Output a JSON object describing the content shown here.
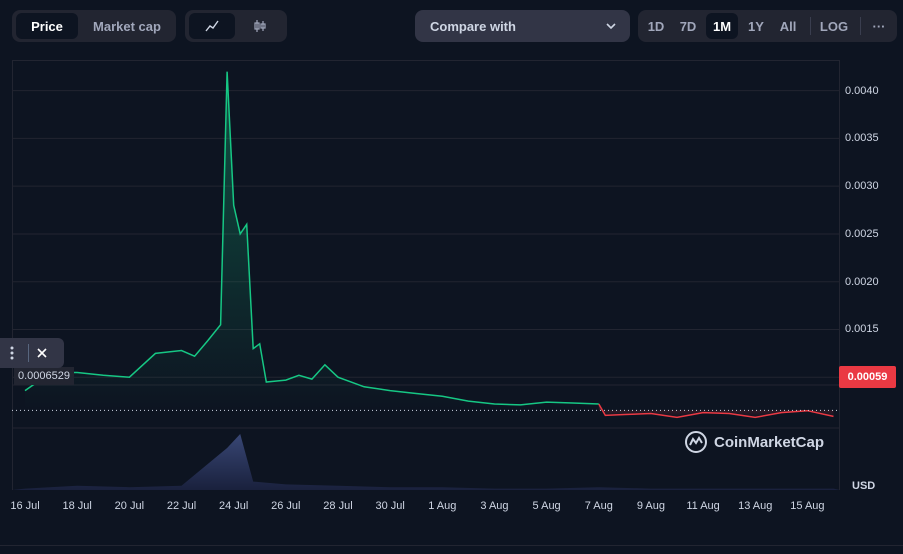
{
  "toolbar": {
    "data_tabs": [
      {
        "label": "Price",
        "active": true
      },
      {
        "label": "Market cap",
        "active": false
      }
    ],
    "chart_types": [
      {
        "icon": "line-chart-icon",
        "active": true
      },
      {
        "icon": "candlestick-icon",
        "active": false
      }
    ],
    "compare_label": "Compare with",
    "ranges": [
      {
        "label": "1D",
        "active": false
      },
      {
        "label": "7D",
        "active": false
      },
      {
        "label": "1M",
        "active": true
      },
      {
        "label": "1Y",
        "active": false
      },
      {
        "label": "All",
        "active": false
      }
    ],
    "log_label": "LOG",
    "more_label": "···"
  },
  "colors": {
    "up": "#16c784",
    "down": "#ea3943",
    "background": "#0d1421",
    "grid": "#222531"
  },
  "current_price_label": "0.00059",
  "hover_price_label": "0.0006529",
  "currency_label": "USD",
  "brand": "CoinMarketCap",
  "chart_data": {
    "type": "line",
    "title": "",
    "xlabel": "",
    "ylabel": "",
    "currency": "USD",
    "ylim": [
      0.0005,
      0.0043
    ],
    "y_ticks": [
      {
        "value": 0.001,
        "label": "0.0010"
      },
      {
        "value": 0.0015,
        "label": "0.0015"
      },
      {
        "value": 0.002,
        "label": "0.0020"
      },
      {
        "value": 0.0025,
        "label": "0.0025"
      },
      {
        "value": 0.003,
        "label": "0.0030"
      },
      {
        "value": 0.0035,
        "label": "0.0035"
      },
      {
        "value": 0.004,
        "label": "0.0040"
      }
    ],
    "x_ticks": [
      "16 Jul",
      "18 Jul",
      "20 Jul",
      "22 Jul",
      "24 Jul",
      "26 Jul",
      "28 Jul",
      "30 Jul",
      "1 Aug",
      "3 Aug",
      "5 Aug",
      "7 Aug",
      "9 Aug",
      "11 Aug",
      "13 Aug",
      "15 Aug"
    ],
    "baseline": 0.0006529,
    "series": [
      {
        "points": [
          [
            "2024-07-16",
            0.00086
          ],
          [
            "2024-07-17",
            0.00105
          ],
          [
            "2024-07-18",
            0.00105
          ],
          [
            "2024-07-19",
            0.00102
          ],
          [
            "2024-07-20",
            0.001
          ],
          [
            "2024-07-21",
            0.00125
          ],
          [
            "2024-07-22",
            0.00128
          ],
          [
            "2024-07-22T12:00",
            0.00122
          ],
          [
            "2024-07-23",
            0.00138
          ],
          [
            "2024-07-23T12:00",
            0.00155
          ],
          [
            "2024-07-23T18:00",
            0.0042
          ],
          [
            "2024-07-24T00:00",
            0.0028
          ],
          [
            "2024-07-24T06:00",
            0.0025
          ],
          [
            "2024-07-24T12:00",
            0.0026
          ],
          [
            "2024-07-24T18:00",
            0.0013
          ],
          [
            "2024-07-25T00:00",
            0.00135
          ],
          [
            "2024-07-25T06:00",
            0.00095
          ],
          [
            "2024-07-26",
            0.00097
          ],
          [
            "2024-07-26T12:00",
            0.00102
          ],
          [
            "2024-07-27",
            0.00098
          ],
          [
            "2024-07-27T12:00",
            0.00113
          ],
          [
            "2024-07-28",
            0.001
          ],
          [
            "2024-07-29",
            0.0009
          ],
          [
            "2024-07-30",
            0.00086
          ],
          [
            "2024-07-31",
            0.00083
          ],
          [
            "2024-08-01",
            0.0008
          ],
          [
            "2024-08-02",
            0.00075
          ],
          [
            "2024-08-03",
            0.00072
          ],
          [
            "2024-08-04",
            0.00071
          ],
          [
            "2024-08-05",
            0.00074
          ],
          [
            "2024-08-06",
            0.00073
          ],
          [
            "2024-08-07",
            0.00072
          ],
          [
            "2024-08-07T06:00",
            0.0006
          ],
          [
            "2024-08-08",
            0.00061
          ],
          [
            "2024-08-09",
            0.00062
          ],
          [
            "2024-08-10",
            0.00058
          ],
          [
            "2024-08-11",
            0.00063
          ],
          [
            "2024-08-12",
            0.00062
          ],
          [
            "2024-08-13",
            0.00058
          ],
          [
            "2024-08-14",
            0.00063
          ],
          [
            "2024-08-15",
            0.00065
          ],
          [
            "2024-08-16",
            0.00059
          ]
        ]
      }
    ],
    "volume": [
      [
        "2024-07-16",
        1
      ],
      [
        "2024-07-18",
        3
      ],
      [
        "2024-07-20",
        2
      ],
      [
        "2024-07-22",
        3
      ],
      [
        "2024-07-23T18:00",
        30
      ],
      [
        "2024-07-24T06:00",
        40
      ],
      [
        "2024-07-24T18:00",
        6
      ],
      [
        "2024-07-26",
        4
      ],
      [
        "2024-07-28",
        3
      ],
      [
        "2024-07-30",
        2
      ],
      [
        "2024-08-01",
        2
      ],
      [
        "2024-08-03",
        1
      ],
      [
        "2024-08-05",
        1
      ],
      [
        "2024-08-07",
        2
      ],
      [
        "2024-08-09",
        1
      ],
      [
        "2024-08-11",
        1
      ],
      [
        "2024-08-13",
        1
      ],
      [
        "2024-08-15",
        1
      ],
      [
        "2024-08-16",
        1
      ]
    ]
  }
}
